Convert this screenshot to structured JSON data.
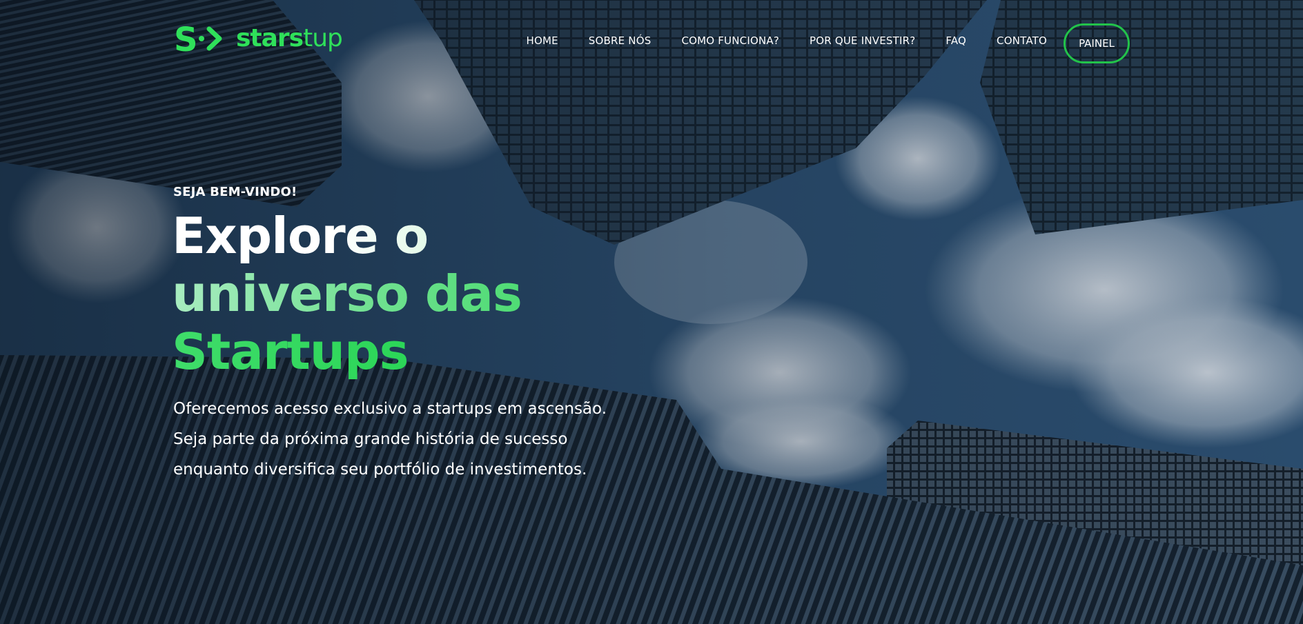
{
  "brand": {
    "name_bold": "stars",
    "name_light": "tup",
    "accent_color": "#2fe05a",
    "logo_icon": "s-arrow-logo-icon"
  },
  "nav": {
    "items": [
      {
        "label": "HOME"
      },
      {
        "label": "SOBRE NÓS"
      },
      {
        "label": "COMO FUNCIONA?"
      },
      {
        "label": "POR QUE INVESTIR?"
      },
      {
        "label": "FAQ"
      },
      {
        "label": "CONTATO"
      }
    ],
    "painel_label": "PAINEL",
    "painel_border_color": "#22c34a"
  },
  "hero": {
    "eyebrow": "SEJA BEM-VINDO!",
    "headline": {
      "line1": "Explore o",
      "line2": "universo das",
      "line3": "Startups"
    },
    "description": {
      "line1": "Oferecemos acesso exclusivo a startups em ascensão.",
      "line2": "Seja parte da próxima grande história de sucesso",
      "line3": "enquanto diversifica seu portfólio de investimentos."
    },
    "background": "skyscrapers-looking-up-photo"
  }
}
